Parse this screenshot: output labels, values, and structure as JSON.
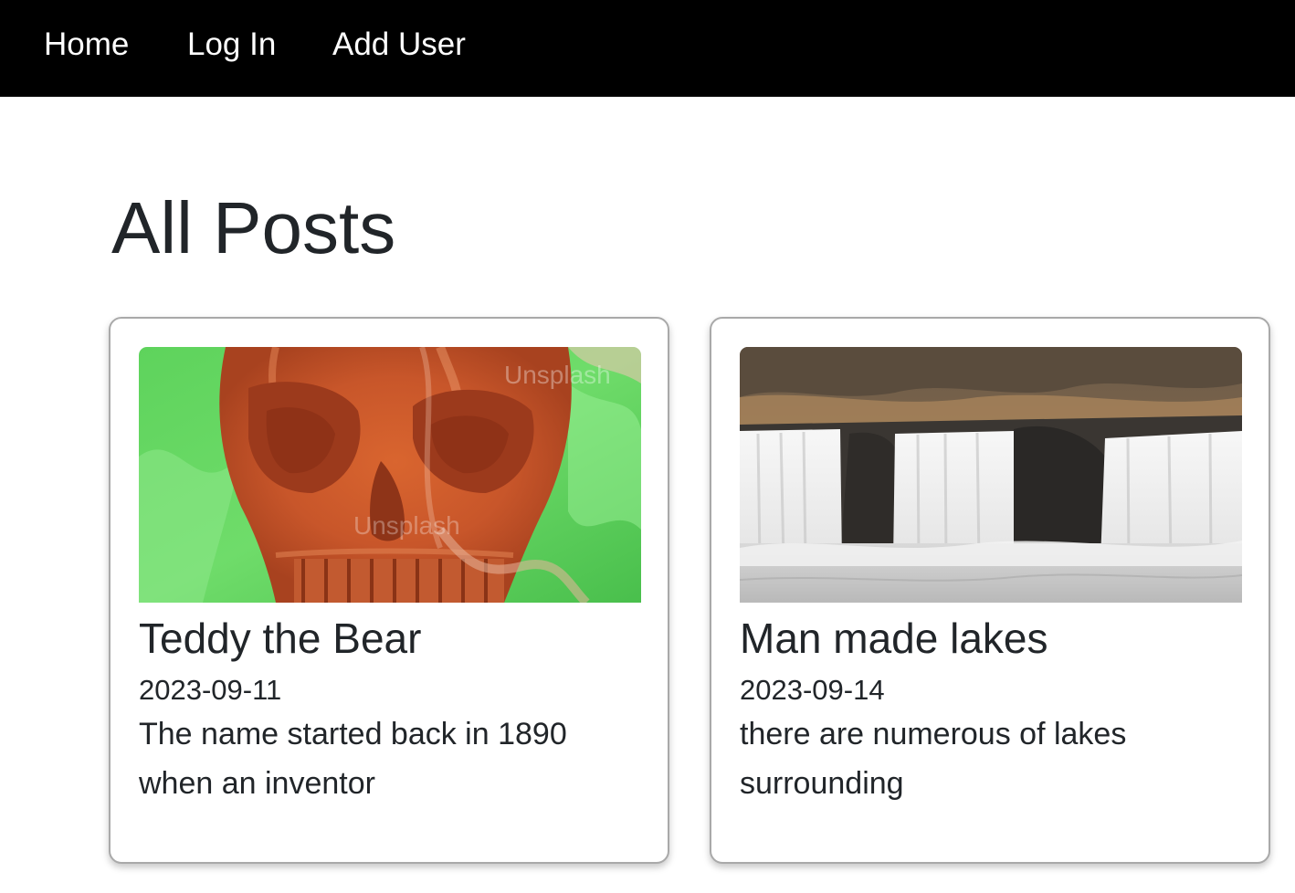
{
  "nav": {
    "home": "Home",
    "login": "Log In",
    "add_user": "Add User"
  },
  "page": {
    "title": "All Posts"
  },
  "posts": [
    {
      "title": "Teddy the Bear",
      "date": "2023-09-11",
      "excerpt": "The name started back in 1890 when an inventor",
      "image": "skull-image",
      "watermark": "Unsplash"
    },
    {
      "title": "Man made lakes",
      "date": "2023-09-14",
      "excerpt": "there are numerous of lakes surrounding",
      "image": "waterfall-image"
    }
  ],
  "colors": {
    "navbar_bg": "#000000",
    "nav_text": "#ffffff",
    "text": "#212529",
    "card_border": "#a9a9a9"
  }
}
